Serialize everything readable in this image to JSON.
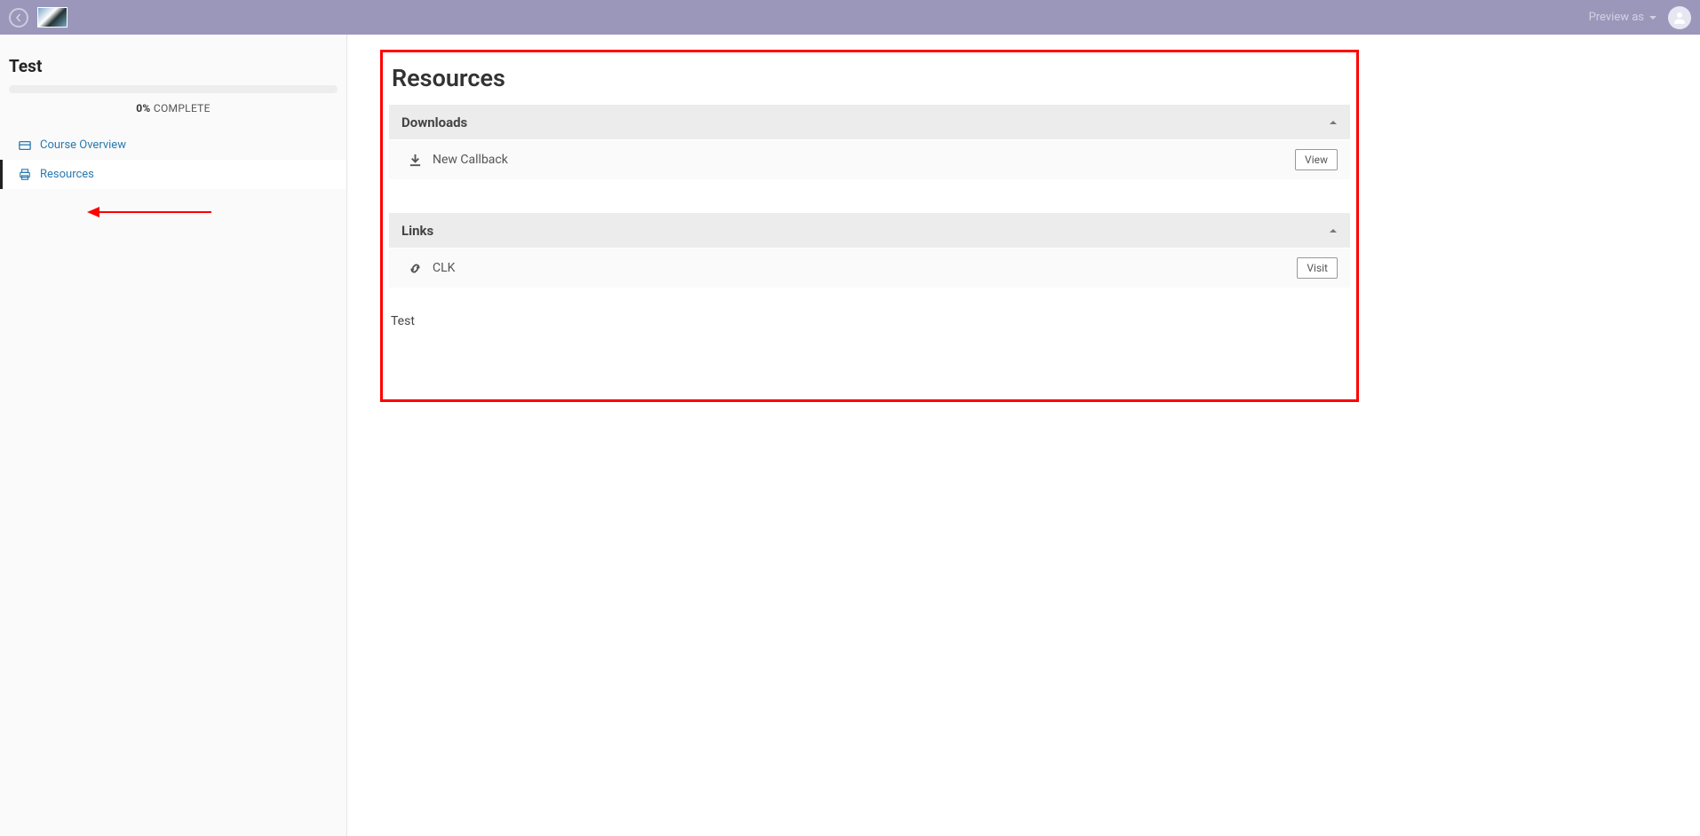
{
  "topbar": {
    "preview_as_label": "Preview as"
  },
  "sidebar": {
    "course_title": "Test",
    "progress_percent": "0%",
    "progress_word": " COMPLETE",
    "items": [
      {
        "label": "Course Overview"
      },
      {
        "label": "Resources"
      }
    ]
  },
  "main": {
    "title": "Resources",
    "sections": [
      {
        "title": "Downloads",
        "rows": [
          {
            "label": "New Callback",
            "action": "View"
          }
        ]
      },
      {
        "title": "Links",
        "rows": [
          {
            "label": "CLK",
            "action": "Visit"
          }
        ]
      }
    ],
    "footer_text": "Test"
  }
}
